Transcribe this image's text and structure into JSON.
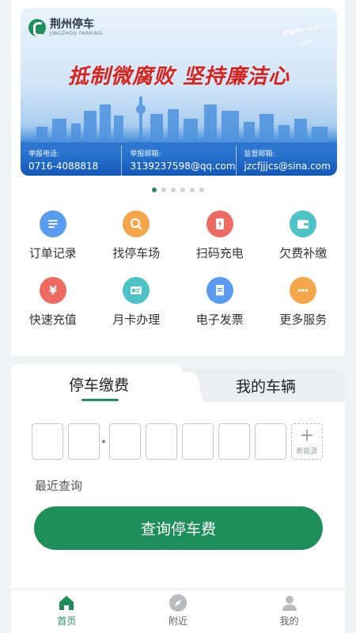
{
  "banner": {
    "logo_cn": "荆州停车",
    "logo_en": "JINGZHOU PARKING",
    "slogan": "抵制微腐败 坚持廉洁心",
    "contacts": [
      {
        "label": "举报电话:",
        "value": "0716-4088818"
      },
      {
        "label": "举报邮箱:",
        "value": "3139237598@qq.com"
      },
      {
        "label": "监督邮箱:",
        "value": "jzcfjjjcs@sina.com"
      }
    ],
    "carousel": {
      "count": 6,
      "active": 0
    }
  },
  "services": [
    {
      "label": "订单记录",
      "icon": "order-list-icon",
      "color": "#5a9cf0"
    },
    {
      "label": "找停车场",
      "icon": "search-parking-icon",
      "color": "#f5a54a"
    },
    {
      "label": "扫码充电",
      "icon": "scan-charge-icon",
      "color": "#ee6b62"
    },
    {
      "label": "欠费补缴",
      "icon": "wallet-icon",
      "color": "#4ec3c7"
    },
    {
      "label": "快速充值",
      "icon": "yuan-icon",
      "color": "#ee6b62"
    },
    {
      "label": "月卡办理",
      "icon": "month-card-icon",
      "color": "#4ec3c7"
    },
    {
      "label": "电子发票",
      "icon": "invoice-icon",
      "color": "#5a9cf0"
    },
    {
      "label": "更多服务",
      "icon": "more-icon",
      "color": "#f5a54a"
    }
  ],
  "parking": {
    "tabs": [
      "停车缴费",
      "我的车辆"
    ],
    "active_tab": 0,
    "plate_slots": 7,
    "new_energy_label": "新能源",
    "recent_label": "最近查询",
    "query_button": "查询停车费"
  },
  "nav": [
    {
      "label": "首页",
      "icon": "home-icon",
      "active": true
    },
    {
      "label": "附近",
      "icon": "compass-icon",
      "active": false
    },
    {
      "label": "我的",
      "icon": "user-icon",
      "active": false
    }
  ],
  "colors": {
    "brand": "#1e8e5a",
    "slogan": "#d6231e",
    "banner_band": "#1457b8"
  }
}
